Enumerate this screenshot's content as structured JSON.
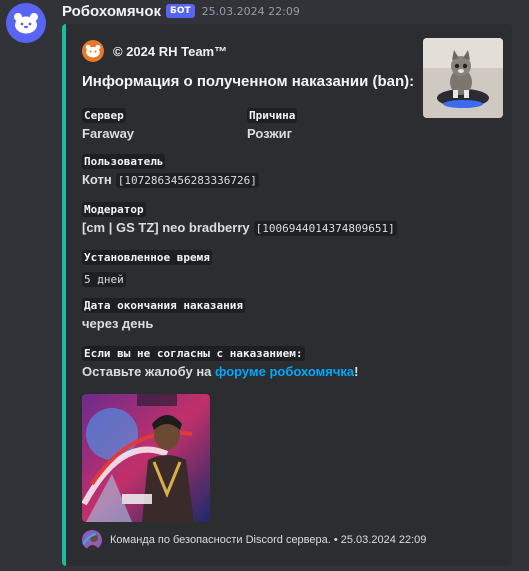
{
  "message": {
    "bot_name": "Робохомячок",
    "bot_badge": "БОТ",
    "timestamp": "25.03.2024 22:09"
  },
  "embed": {
    "accent_color": "#1abc9c",
    "author_name": "© 2024 RH Team™",
    "title": "Информация о полученном наказании (ban):",
    "fields": {
      "server": {
        "name": "Сервер",
        "value": "Faraway"
      },
      "reason": {
        "name": "Причина",
        "value": "Розжиг"
      },
      "user": {
        "name": "Пользователь",
        "value": "Котн",
        "id": "[1072863456283336726]"
      },
      "moderator": {
        "name": "Модератор",
        "value": "[cm | GS TZ] neo bradberry",
        "id": "[1006944014374809651]"
      },
      "duration": {
        "name": "Установленное время",
        "value": "5 дней"
      },
      "end_date": {
        "name": "Дата окончания наказания",
        "value": "через день"
      },
      "appeal": {
        "name": "Если вы не согласны с наказанием:",
        "prefix": "Оставьте жалобу на ",
        "link": "форуме робохомячка",
        "suffix": "!"
      }
    },
    "footer_text": "Команда по безопасности Discord сервера. • 25.03.2024 22:09"
  }
}
